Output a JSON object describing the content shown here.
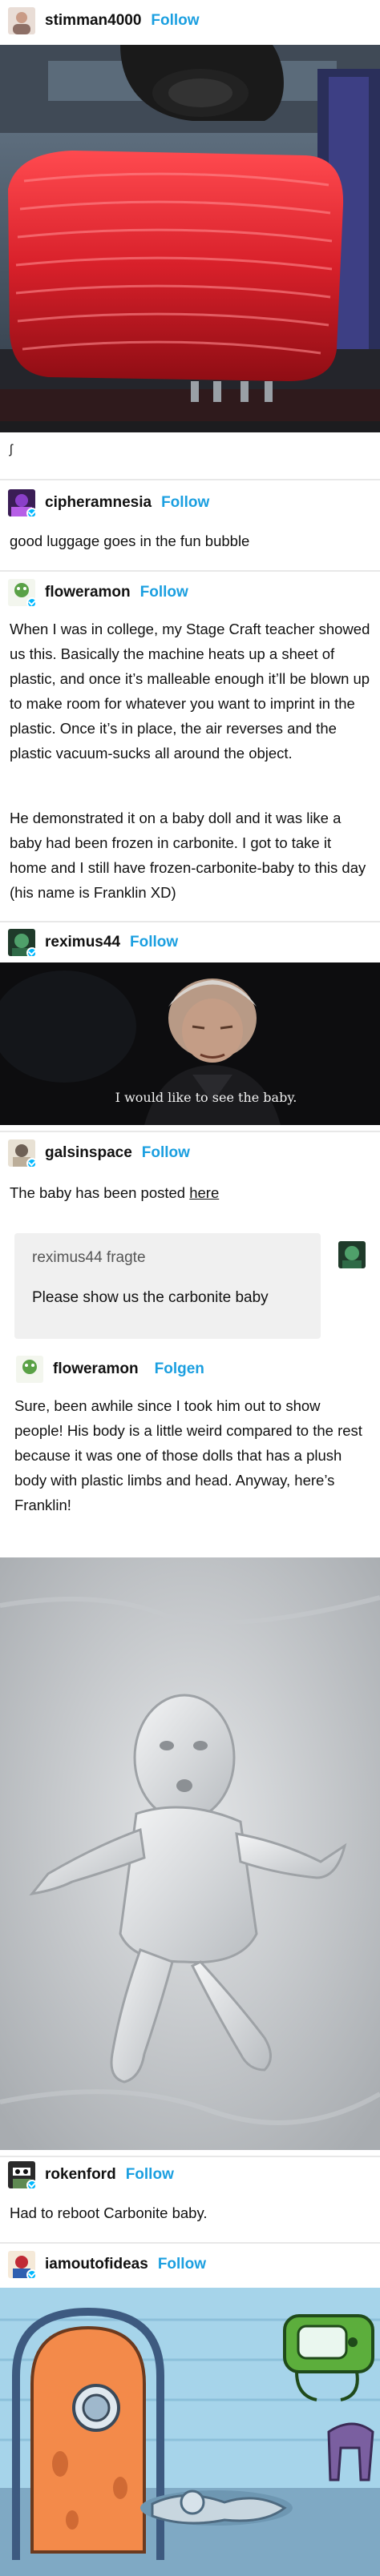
{
  "posts": [
    {
      "username": "stimman4000",
      "follow": "Follow"
    },
    {
      "username": "cipheramnesia",
      "follow": "Follow",
      "text": "good luggage goes in the fun bubble"
    },
    {
      "username": "floweramon",
      "follow": "Follow",
      "paragraph1": "When I was in college, my Stage Craft teacher showed us this.  Basically the machine heats up a sheet of plastic, and once it’s malleable enough it’ll be blown up to make room for whatever you want to imprint in the plastic.  Once it’s in place, the air reverses and the plastic vacuum-sucks all around the object.",
      "paragraph2": "He demonstrated it on a baby doll and it was like a baby had been frozen in carbonite.  I got to take it home and I still have frozen-carbonite-baby to this day (his name is Franklin XD)"
    },
    {
      "username": "reximus44",
      "follow": "Follow",
      "subtitle": "I would like to see the baby."
    },
    {
      "username": "galsinspace",
      "follow": "Follow",
      "text_prefix": "The baby has been posted ",
      "link": "here"
    },
    {
      "username": "floweramon",
      "follow": "Folgen",
      "text": "Sure, been awhile since I took him out to show people!  His body is a little weird compared to the rest because it was one of those dolls that has a plush body with plastic limbs and head.  Anyway, here’s Franklin!"
    },
    {
      "username": "rokenford",
      "follow": "Follow",
      "text": "Had to reboot Carbonite baby."
    },
    {
      "username": "iamoutofideas",
      "follow": "Follow"
    }
  ],
  "gif_caption": "ʃ",
  "ask": {
    "from": "reximus44 fragte",
    "question": "Please show us the carbonite baby"
  },
  "colors": {
    "follow": "#1b9fe0",
    "verified_badge": "#00b8ff",
    "luggage_red": "#d8202a"
  }
}
